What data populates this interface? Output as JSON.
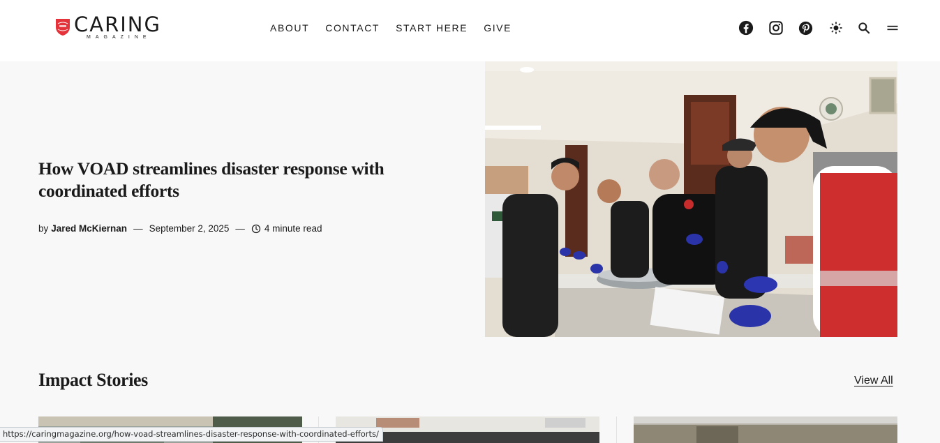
{
  "brand": {
    "name": "CARING",
    "sub": "MAGAZINE",
    "shield_text": "THE SALVATION ARMY",
    "accent": "#e4333b"
  },
  "nav": {
    "items": [
      {
        "label": "ABOUT"
      },
      {
        "label": "CONTACT"
      },
      {
        "label": "START HERE"
      },
      {
        "label": "GIVE"
      }
    ]
  },
  "header_icons": [
    "facebook-icon",
    "instagram-icon",
    "pinterest-icon",
    "sun-icon",
    "search-icon",
    "menu-icon"
  ],
  "hero": {
    "title": "How VOAD streamlines disaster response with coordinated efforts",
    "by": "by",
    "author": "Jared McKiernan",
    "dash": "—",
    "date": "September 2, 2025",
    "read_time": "4 minute read",
    "image_alt": "Salvation Army volunteers preparing food in a kitchen"
  },
  "section": {
    "title": "Impact Stories",
    "view_all": "View All"
  },
  "status_url": "https://caringmagazine.org/how-voad-streamlines-disaster-response-with-coordinated-efforts/"
}
